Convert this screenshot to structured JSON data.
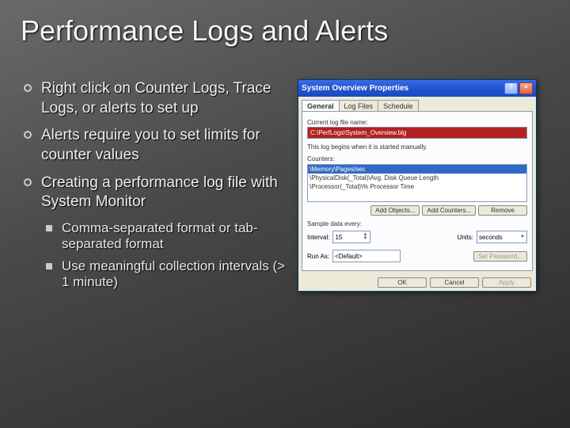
{
  "title": "Performance Logs and Alerts",
  "bullets": [
    "Right click on Counter Logs, Trace Logs, or alerts to set up",
    "Alerts require you to set limits for counter values",
    "Creating a performance log file with System Monitor"
  ],
  "sub_bullets": [
    "Comma-separated format or tab-separated format",
    "Use meaningful collection intervals (> 1 minute)"
  ],
  "dialog": {
    "title": "System Overview Properties",
    "tabs": [
      "General",
      "Log Files",
      "Schedule"
    ],
    "current_log_label": "Current log file name:",
    "current_log_value": "C:\\PerfLogs\\System_Overview.blg",
    "begins_label": "This log begins when it is started manually.",
    "counters_label": "Counters:",
    "counters": [
      "\\Memory\\Pages/sec",
      "\\PhysicalDisk(_Total)\\Avg. Disk Queue Length",
      "\\Processor(_Total)\\% Processor Time"
    ],
    "add_objects": "Add Objects...",
    "add_counters": "Add Counters...",
    "remove": "Remove",
    "sample_label": "Sample data every:",
    "interval_label": "Interval:",
    "interval_value": "15",
    "units_label": "Units:",
    "units_value": "seconds",
    "runas_label": "Run As:",
    "runas_value": "<Default>",
    "set_password": "Set Password...",
    "ok": "OK",
    "cancel": "Cancel",
    "apply": "Apply"
  }
}
